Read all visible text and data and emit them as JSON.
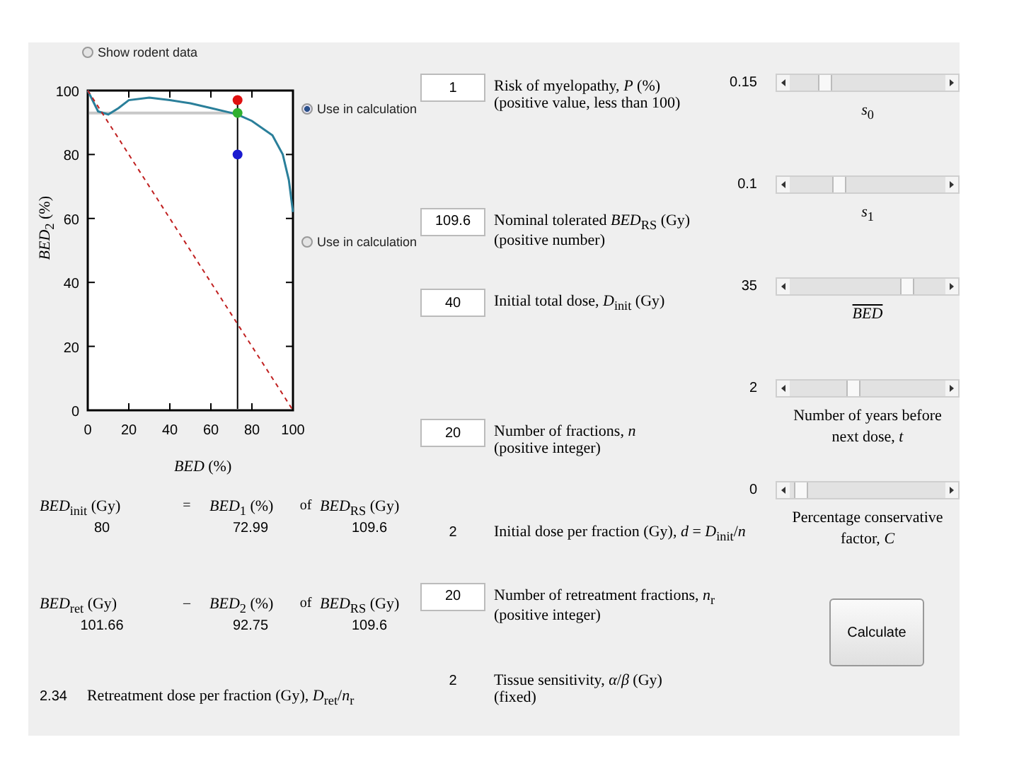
{
  "rodent_toggle": {
    "label": "Show rodent data",
    "selected": false
  },
  "chart": {
    "chart_data": {
      "type": "line",
      "xlabel": "*BED* (%)",
      "ylabel": "*BED*$_{2}$ (%)",
      "x": [
        0,
        5,
        10,
        15,
        20,
        30,
        40,
        50,
        60,
        70,
        73,
        80,
        90,
        95,
        98,
        100
      ],
      "xlim": [
        0,
        100
      ],
      "ylim": [
        0,
        100
      ],
      "xticks": [
        0,
        20,
        40,
        60,
        80,
        100
      ],
      "yticks": [
        0,
        20,
        40,
        60,
        80,
        100
      ],
      "ref_lines": [
        {
          "axis": "x",
          "value": 73,
          "color": "#000000"
        },
        {
          "axis": "y",
          "value": 93,
          "color": "#c8c8c8"
        }
      ],
      "series": [
        {
          "color": "#2a7f9a",
          "line_style": "solid",
          "values": [
            100,
            93.5,
            92.5,
            94.5,
            97,
            97.8,
            97,
            96,
            94.5,
            93,
            92.5,
            90.5,
            86,
            80,
            72,
            62
          ]
        },
        {
          "color": "#c02020",
          "line_style": "dashed",
          "values": [
            100,
            95,
            90,
            85,
            80,
            70,
            60,
            50,
            40,
            30,
            27,
            20,
            10,
            5,
            2,
            0
          ]
        },
        {
          "color": "#e01010",
          "line_style": "none",
          "marker": "circle",
          "values": [
            null,
            null,
            null,
            null,
            null,
            null,
            null,
            null,
            null,
            null,
            97,
            null,
            null,
            null,
            null,
            null
          ]
        },
        {
          "color": "#30b030",
          "line_style": "none",
          "marker": "circle",
          "values": [
            null,
            null,
            null,
            null,
            null,
            null,
            null,
            null,
            null,
            null,
            93,
            null,
            null,
            null,
            null,
            null
          ]
        },
        {
          "color": "#1a1ad0",
          "line_style": "none",
          "marker": "circle",
          "values": [
            null,
            null,
            null,
            null,
            null,
            null,
            null,
            null,
            null,
            null,
            80,
            null,
            null,
            null,
            null,
            null
          ]
        }
      ]
    }
  },
  "calc_toggles": [
    {
      "label": "Use in calculation",
      "selected": true
    },
    {
      "label": "Use in calculation",
      "selected": false
    }
  ],
  "results": [
    {
      "label": "*BED*$_{init}$ (Gy)",
      "operator": "=",
      "percent_label": "*BED*$_{1}$ (%)",
      "of": "of",
      "reference_label": "*BED*$_{RS}$ (Gy)",
      "value": "80",
      "percent": "72.99",
      "reference": "109.6"
    },
    {
      "label": "*BED*$_{ret}$ (Gy)",
      "operator": "–",
      "percent_label": "*BED*$_{2}$ (%)",
      "of": "of",
      "reference_label": "*BED*$_{RS}$ (Gy)",
      "value": "101.66",
      "percent": "92.75",
      "reference": "109.6"
    }
  ],
  "retreatment_dose": {
    "value": "2.34",
    "label": "Retreatment dose per fraction (Gy), *D*$_{ret}$/*n*$_{r}$"
  },
  "parameters": [
    {
      "kind": "input",
      "value": "1",
      "label": "Risk of myelopathy, *P* (%)",
      "note": "(positive value, less than 100)"
    },
    {
      "kind": "input",
      "value": "109.6",
      "label": "Nominal tolerated *BED*$_{RS}$ (Gy)",
      "note": "(positive number)"
    },
    {
      "kind": "input",
      "value": "40",
      "label": "Initial total dose, *D*$_{init}$ (Gy)"
    },
    {
      "kind": "input",
      "value": "20",
      "label": "Number of fractions, *n*",
      "note": "(positive integer)"
    },
    {
      "kind": "display",
      "value": "2",
      "label": "Initial dose per fraction (Gy), *d* = *D*$_{init}$/*n*"
    },
    {
      "kind": "input",
      "value": "20",
      "label": "Number of retreatment fractions, *n*$_{r}$",
      "note": "(positive integer)"
    },
    {
      "kind": "display",
      "value": "2",
      "label": "Tissue sensitivity, *α*/*β* (Gy)",
      "note": "(fixed)"
    }
  ],
  "sliders": [
    {
      "value": "0.15",
      "level": 0.2,
      "label": "*s*$_{0}$",
      "overlined": false
    },
    {
      "value": "0.1",
      "level": 0.3,
      "label": "*s*$_{1}$",
      "overlined": false
    },
    {
      "value": "35",
      "level": 0.78,
      "label": "*BED*",
      "overlined": true
    },
    {
      "value": "2",
      "level": 0.4,
      "label": "Number of years before next dose, *t*",
      "overlined": false
    },
    {
      "value": "0",
      "level": 0.03,
      "label": "Percentage conservative factor, *C*",
      "overlined": false
    }
  ],
  "calculate_button": "Calculate"
}
